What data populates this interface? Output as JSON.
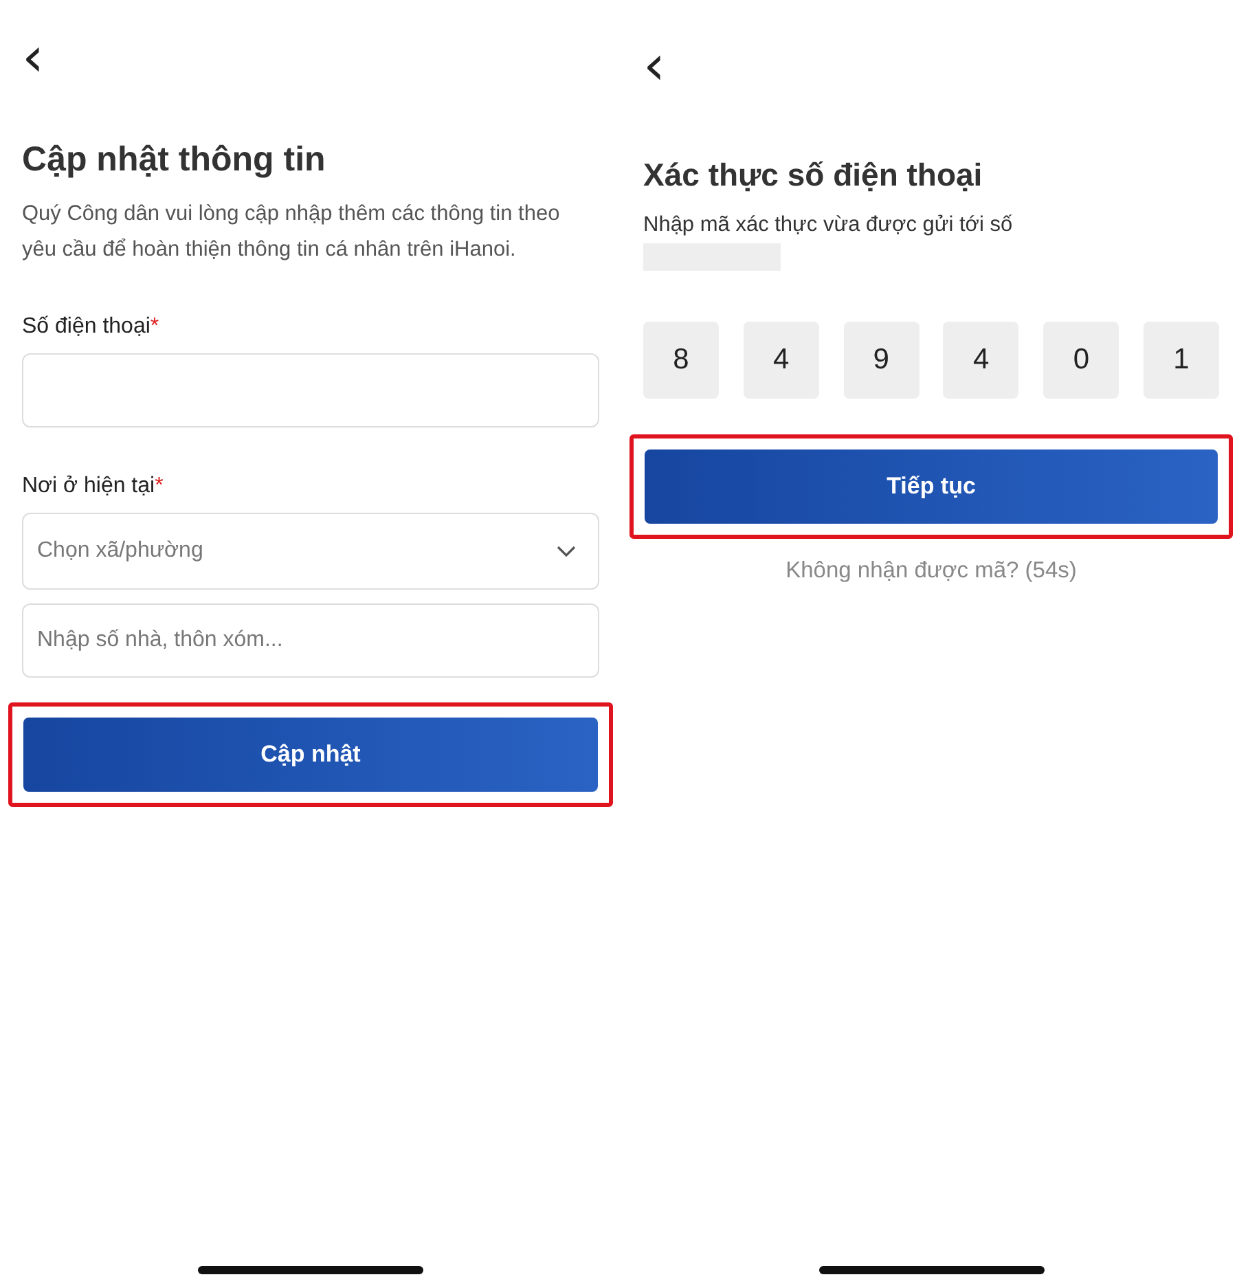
{
  "screens": [
    {
      "kind": "form",
      "back": "‹",
      "title": "Cập nhật thông tin",
      "description": "Quý Công dân vui lòng cập nhập thêm các thông tin theo yêu cầu để hoàn thiện thông tin cá nhân trên iHanoi.",
      "fields": [
        {
          "kind": "input",
          "label": "Số điện thoại",
          "required_mark": "*"
        },
        {
          "kind": "select",
          "label": "Nơi ở hiện tại",
          "required_mark": "*",
          "placeholder": "Chọn xã/phường"
        },
        {
          "kind": "input",
          "placeholder": "Nhập số nhà, thôn xóm..."
        }
      ],
      "button": {
        "label": "Cập nhật",
        "highlighted": true
      }
    },
    {
      "kind": "otp",
      "back": "‹",
      "title": "Xác thực số điện thoại",
      "description": "Nhập mã xác thực vừa được gửi tới số",
      "redacted": true,
      "digits": [
        "8",
        "4",
        "9",
        "4",
        "0",
        "1"
      ],
      "button": {
        "label": "Tiếp tục",
        "highlighted": true
      },
      "resend": "Không nhận được mã? (54s)"
    }
  ]
}
